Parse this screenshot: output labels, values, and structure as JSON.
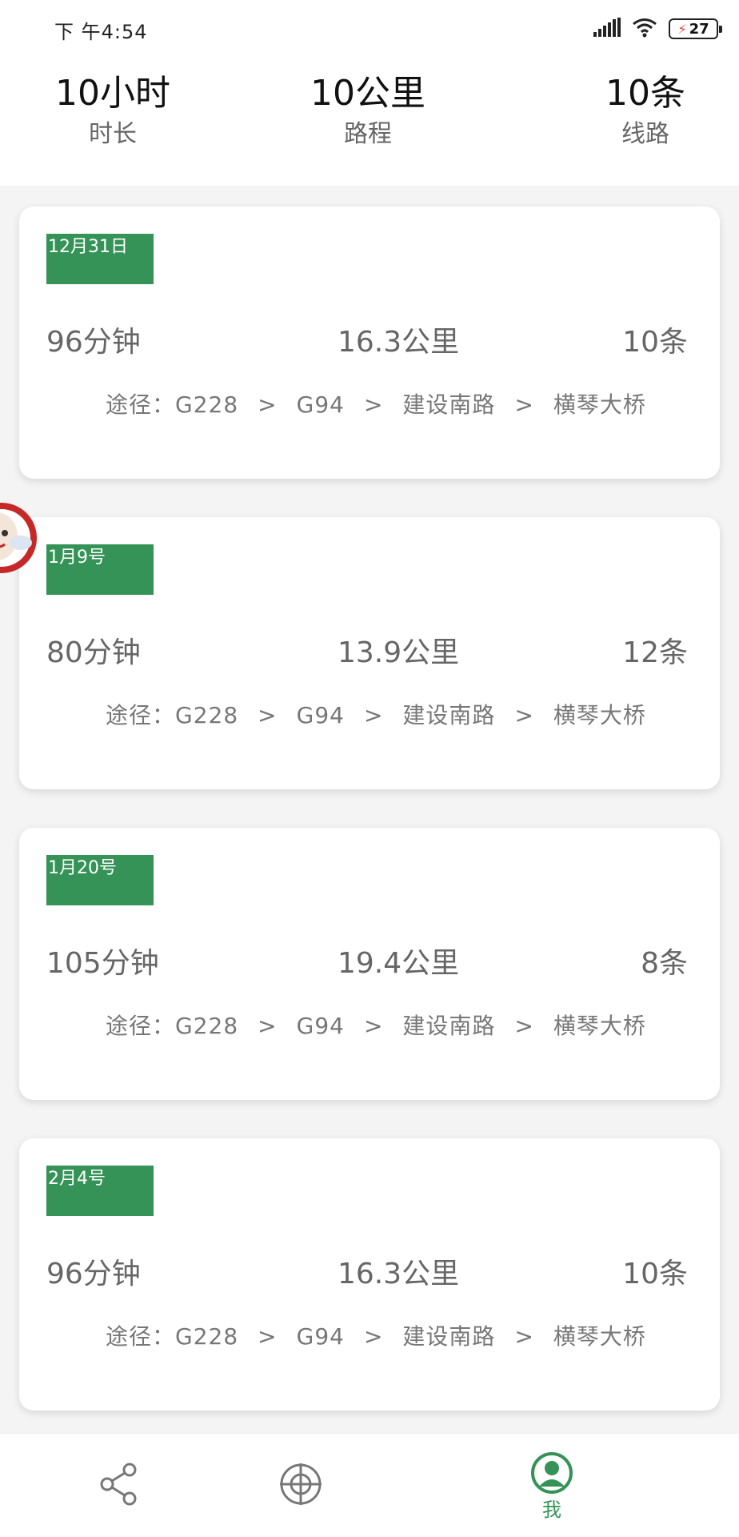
{
  "status_bar": {
    "time": "下 午4:54",
    "battery": "27",
    "icons": [
      "signal-icon",
      "wifi-icon",
      "battery-charging-icon"
    ]
  },
  "summary": {
    "duration_value": "10小时",
    "duration_label": "时长",
    "distance_value": "10公里",
    "distance_label": "路程",
    "routes_value": "10条",
    "routes_label": "线路"
  },
  "trips": [
    {
      "date": "12月31日",
      "time": "96分钟",
      "distance": "16.3公里",
      "count": "10条",
      "route_prefix": "途径：",
      "route": [
        "G228",
        "G94",
        "建设南路",
        "横琴大桥"
      ]
    },
    {
      "date": "1月9号",
      "time": "80分钟",
      "distance": "13.9公里",
      "count": "12条",
      "route_prefix": "途径：",
      "route": [
        "G228",
        "G94",
        "建设南路",
        "横琴大桥"
      ]
    },
    {
      "date": "1月20号",
      "time": "105分钟",
      "distance": "19.4公里",
      "count": "8条",
      "route_prefix": "途径：",
      "route": [
        "G228",
        "G94",
        "建设南路",
        "横琴大桥"
      ]
    },
    {
      "date": "2月4号",
      "time": "96分钟",
      "distance": "16.3公里",
      "count": "10条",
      "route_prefix": "途径：",
      "route": [
        "G228",
        "G94",
        "建设南路",
        "横琴大桥"
      ]
    }
  ],
  "route_separator": ">",
  "bottom_nav": {
    "items": [
      {
        "icon": "share-icon",
        "label": ""
      },
      {
        "icon": "target-icon",
        "label": ""
      },
      {
        "icon": "user-profile-icon",
        "label": "我"
      }
    ]
  },
  "colors": {
    "accent": "#359357",
    "date_tag": "#359357",
    "background": "#f4f4f4"
  }
}
